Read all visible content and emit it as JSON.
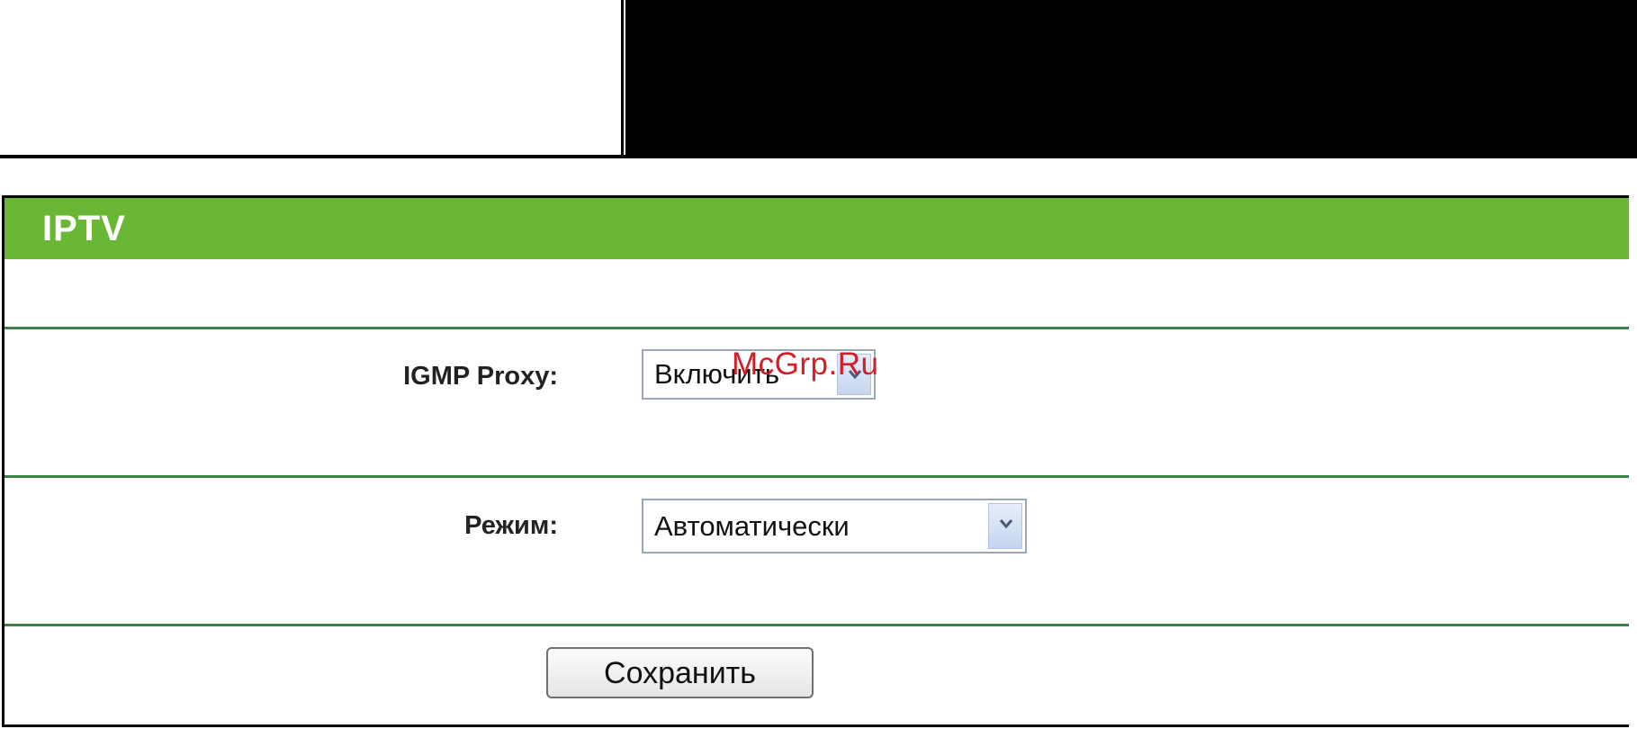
{
  "panel": {
    "title": "IPTV"
  },
  "igmp_proxy": {
    "label": "IGMP Proxy:",
    "selected": "Включить"
  },
  "mode": {
    "label": "Режим:",
    "selected": "Автоматически"
  },
  "actions": {
    "save_label": "Сохранить"
  },
  "watermark": {
    "text": "McGrp.Ru"
  },
  "colors": {
    "header_green": "#6ab735",
    "divider_green": "#3d7f4a",
    "watermark_red": "#d11f2a"
  },
  "icons": {
    "dropdown": "chevron-down-icon"
  }
}
